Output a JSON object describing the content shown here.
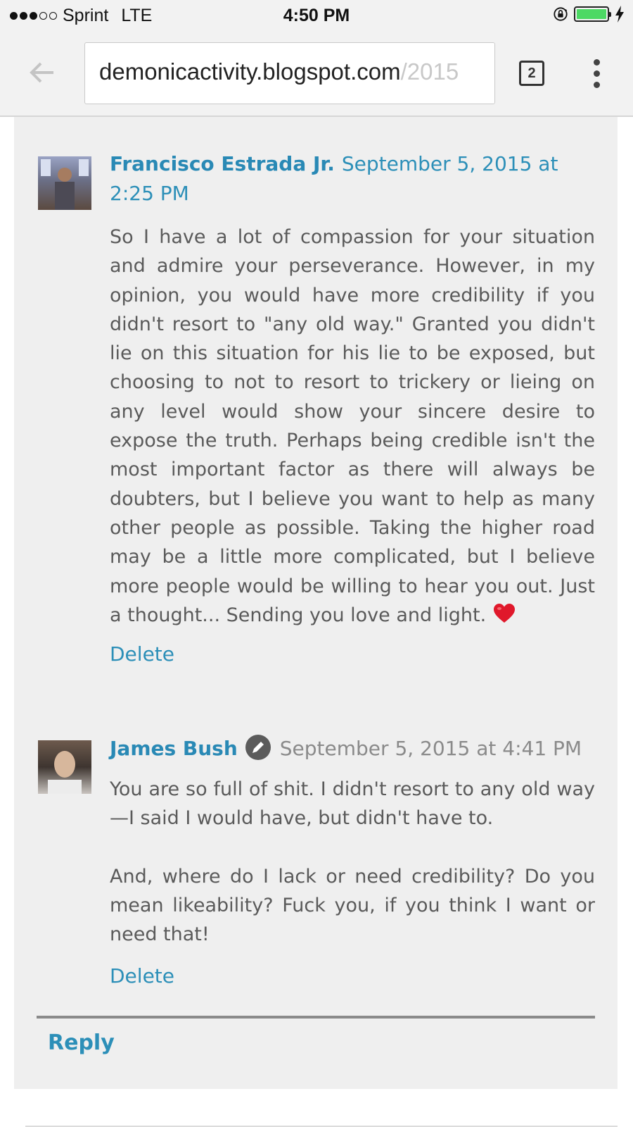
{
  "status_bar": {
    "carrier": "Sprint",
    "network": "LTE",
    "time": "4:50 PM",
    "signal_bars_filled": 3,
    "signal_bars_total": 5,
    "battery_level": 1.0
  },
  "toolbar": {
    "url_domain": "demonicactivity.blogspot.com",
    "url_path": "/2015",
    "tab_count": "2"
  },
  "comments": [
    {
      "author": "Francisco Estrada Jr.",
      "date": "September 5, 2015 at 2:25 PM",
      "body": "So I have a lot of compassion for your situation and admire your perseverance. However, in my opinion, you would have more credibility if you didn't resort to \"any old way.\" Granted you didn't lie on this situation for his lie to be exposed, but choosing to not to resort to trickery or lieing on any level would show your sincere desire to expose the truth. Perhaps being credible isn't the most important factor as there will always be doubters, but I believe you want to help as many other people as possible. Taking the higher road may be a little more complicated, but I believe more people would be willing to hear you out. Just a thought... Sending you love and light.",
      "delete_label": "Delete"
    },
    {
      "author": "James Bush",
      "date": "September 5, 2015 at 4:41 PM",
      "body_p1": "You are so full of shit. I didn't resort to any old way—I said I would have, but didn't have to.",
      "body_p2": "And, where do I lack or need credibility? Do you mean likeability? Fuck you, if you think I want or need that!",
      "delete_label": "Delete"
    }
  ],
  "reply_label": "Reply",
  "icons": {
    "back": "back-arrow-icon",
    "menu": "overflow-menu-icon",
    "edit": "pencil-icon",
    "heart": "heart-icon",
    "lock": "orientation-lock-icon",
    "bolt": "charging-bolt-icon"
  },
  "colors": {
    "link": "#2c8fb8",
    "body_text": "#5a5a5a",
    "panel_bg": "#efefef",
    "battery": "#4cd964",
    "heart": "#e0182b"
  }
}
